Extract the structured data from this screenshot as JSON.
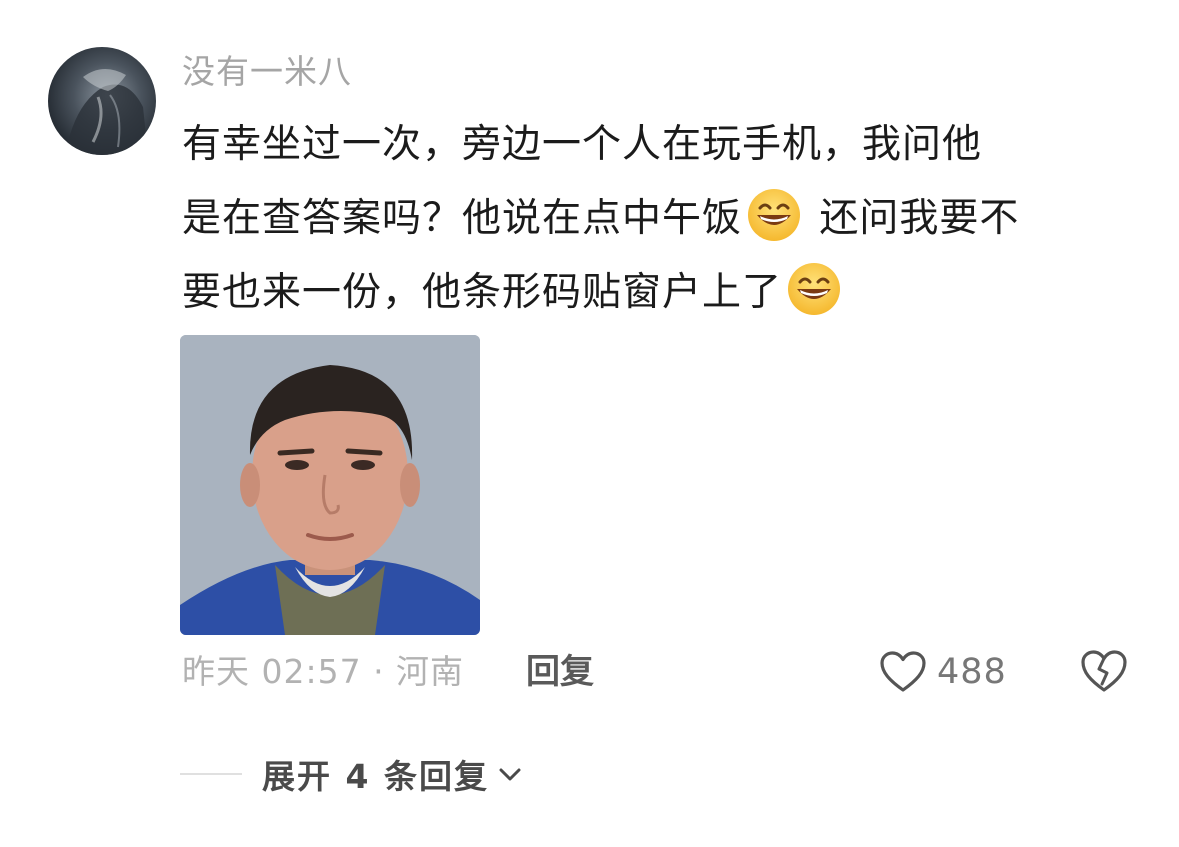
{
  "comment": {
    "username": "没有一米八",
    "text_lines": [
      "有幸坐过一次，旁边一个人在玩手机，我问他",
      "是在查答案吗？他说在点中午饭",
      " 还问我要不",
      "要也来一份，他条形码贴窗户上了"
    ],
    "emoji_icon": "grinning-face-icon",
    "meta": "昨天 02:57 · 河南",
    "reply_label": "回复",
    "like_count": "488",
    "expand_label": "展开 4 条回复"
  },
  "colors": {
    "username": "#a5a5a5",
    "text": "#1b1b1b",
    "meta": "#b2b2b2",
    "action": "#5a5a5a"
  }
}
